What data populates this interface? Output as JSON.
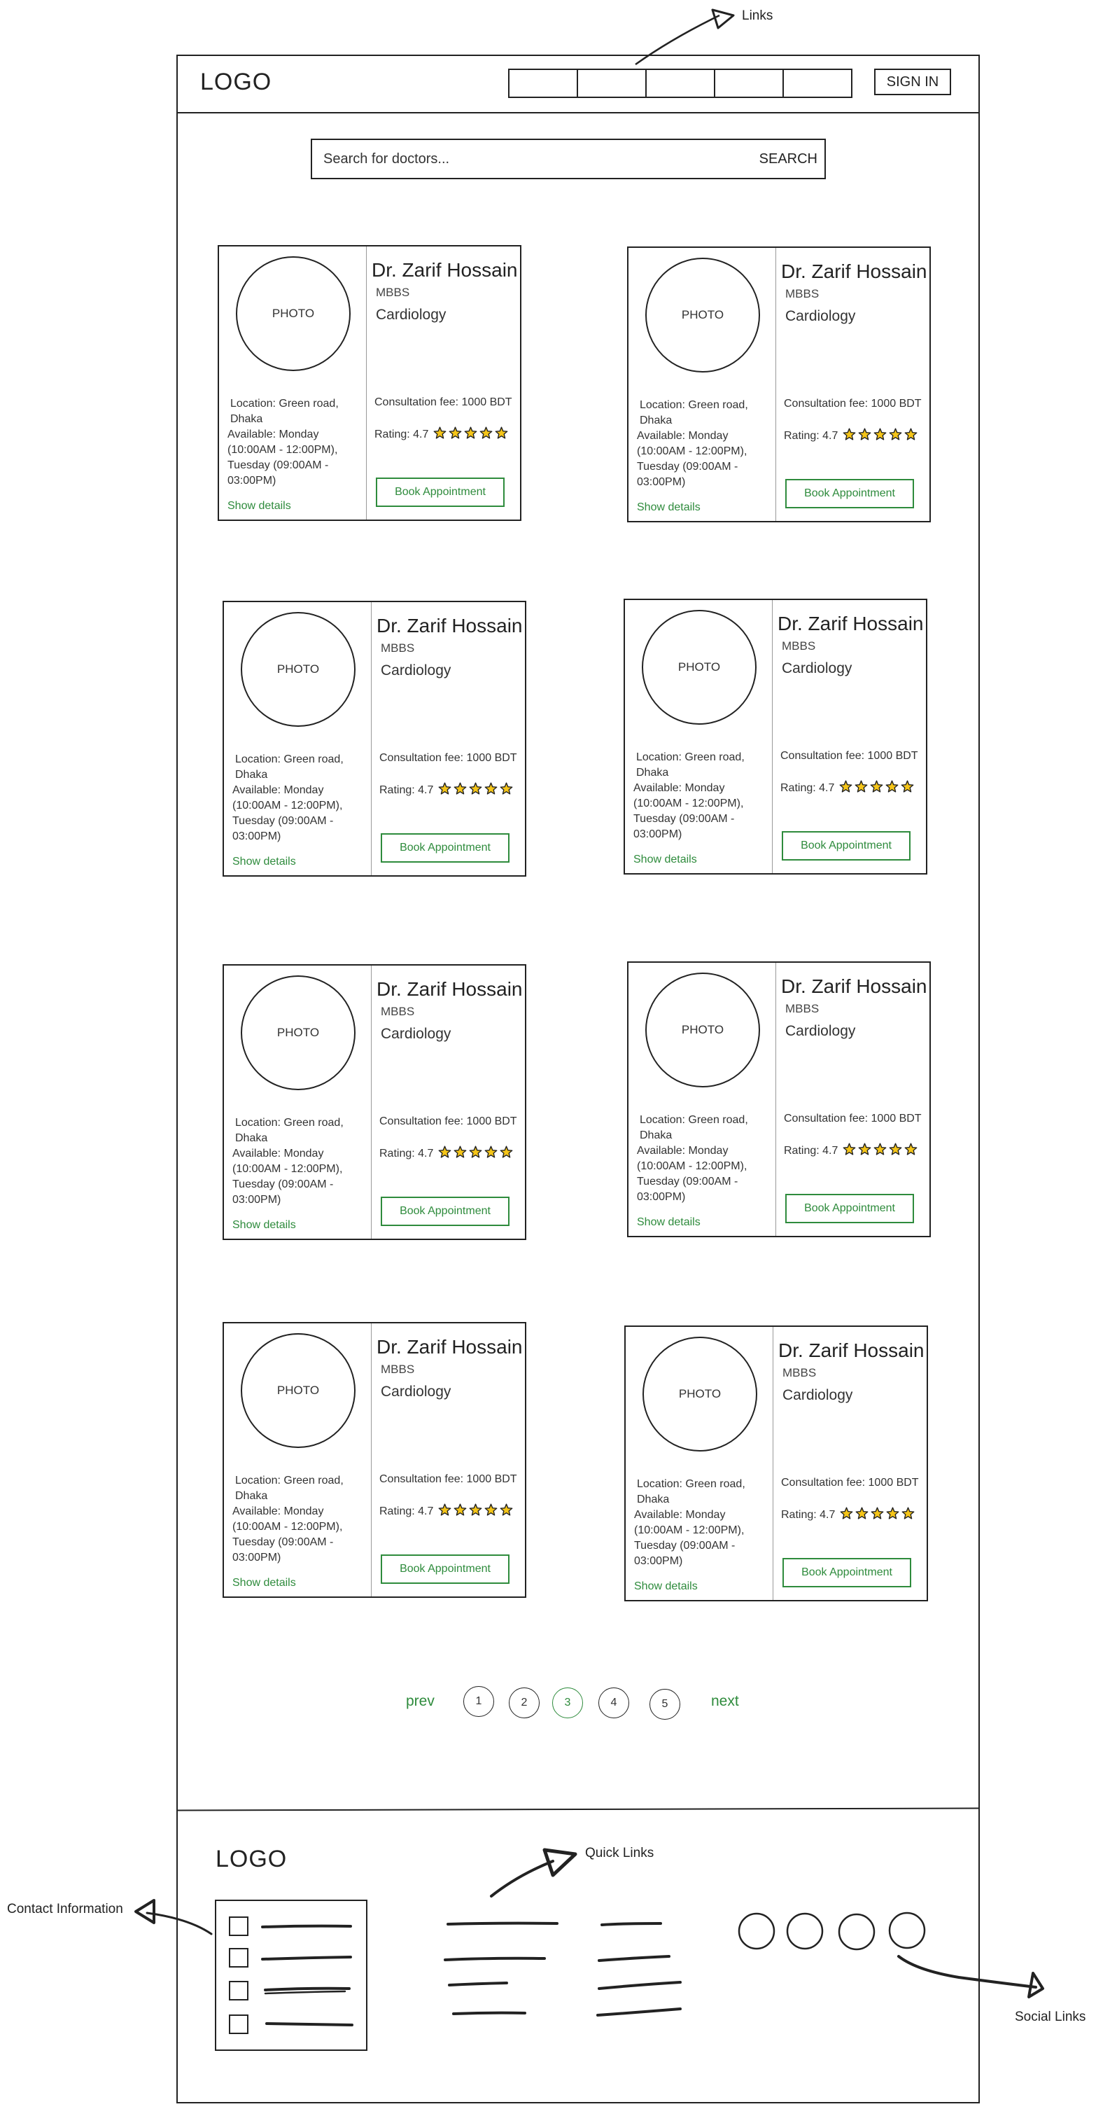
{
  "header": {
    "logo": "LOGO",
    "signin_label": "SIGN IN",
    "nav_link_count": 5
  },
  "search": {
    "placeholder": "Search for doctors...",
    "button_label": "SEARCH"
  },
  "doctor_cards": [
    {
      "photo_label": "PHOTO",
      "name": "Dr. Zarif Hossain",
      "degree": "MBBS",
      "specialty": "Cardiology",
      "location": "Location: Green road, Dhaka",
      "availability": "Available:  Monday (10:00AM - 12:00PM), Tuesday (09:00AM - 03:00PM)",
      "show_details": "Show details",
      "fee": "Consultation fee: 1000 BDT",
      "rating_label": "Rating: 4.7",
      "rating_stars": 5,
      "book_label": "Book Appointment"
    },
    {
      "photo_label": "PHOTO",
      "name": "Dr. Zarif Hossain",
      "degree": "MBBS",
      "specialty": "Cardiology",
      "location": "Location: Green road, Dhaka",
      "availability": "Available:  Monday (10:00AM - 12:00PM), Tuesday (09:00AM - 03:00PM)",
      "show_details": "Show details",
      "fee": "Consultation fee: 1000 BDT",
      "rating_label": "Rating: 4.7",
      "rating_stars": 5,
      "book_label": "Book Appointment"
    },
    {
      "photo_label": "PHOTO",
      "name": "Dr. Zarif Hossain",
      "degree": "MBBS",
      "specialty": "Cardiology",
      "location": "Location: Green road, Dhaka",
      "availability": "Available:  Monday (10:00AM - 12:00PM), Tuesday (09:00AM - 03:00PM)",
      "show_details": "Show details",
      "fee": "Consultation fee: 1000 BDT",
      "rating_label": "Rating: 4.7",
      "rating_stars": 5,
      "book_label": "Book Appointment"
    },
    {
      "photo_label": "PHOTO",
      "name": "Dr. Zarif Hossain",
      "degree": "MBBS",
      "specialty": "Cardiology",
      "location": "Location: Green road, Dhaka",
      "availability": "Available:  Monday (10:00AM - 12:00PM), Tuesday (09:00AM - 03:00PM)",
      "show_details": "Show details",
      "fee": "Consultation fee: 1000 BDT",
      "rating_label": "Rating: 4.7",
      "rating_stars": 5,
      "book_label": "Book Appointment"
    },
    {
      "photo_label": "PHOTO",
      "name": "Dr. Zarif Hossain",
      "degree": "MBBS",
      "specialty": "Cardiology",
      "location": "Location: Green road, Dhaka",
      "availability": "Available:  Monday (10:00AM - 12:00PM), Tuesday (09:00AM - 03:00PM)",
      "show_details": "Show details",
      "fee": "Consultation fee: 1000 BDT",
      "rating_label": "Rating: 4.7",
      "rating_stars": 5,
      "book_label": "Book Appointment"
    },
    {
      "photo_label": "PHOTO",
      "name": "Dr. Zarif Hossain",
      "degree": "MBBS",
      "specialty": "Cardiology",
      "location": "Location: Green road, Dhaka",
      "availability": "Available:  Monday (10:00AM - 12:00PM), Tuesday (09:00AM - 03:00PM)",
      "show_details": "Show details",
      "fee": "Consultation fee: 1000 BDT",
      "rating_label": "Rating: 4.7",
      "rating_stars": 5,
      "book_label": "Book Appointment"
    },
    {
      "photo_label": "PHOTO",
      "name": "Dr. Zarif Hossain",
      "degree": "MBBS",
      "specialty": "Cardiology",
      "location": "Location: Green road, Dhaka",
      "availability": "Available:  Monday (10:00AM - 12:00PM), Tuesday (09:00AM - 03:00PM)",
      "show_details": "Show details",
      "fee": "Consultation fee: 1000 BDT",
      "rating_label": "Rating: 4.7",
      "rating_stars": 5,
      "book_label": "Book Appointment"
    },
    {
      "photo_label": "PHOTO",
      "name": "Dr. Zarif Hossain",
      "degree": "MBBS",
      "specialty": "Cardiology",
      "location": "Location: Green road, Dhaka",
      "availability": "Available:  Monday (10:00AM - 12:00PM), Tuesday (09:00AM - 03:00PM)",
      "show_details": "Show details",
      "fee": "Consultation fee: 1000 BDT",
      "rating_label": "Rating: 4.7",
      "rating_stars": 5,
      "book_label": "Book Appointment"
    }
  ],
  "pagination": {
    "prev": "prev",
    "next": "next",
    "pages": [
      "1",
      "2",
      "3",
      "4",
      "5"
    ],
    "current": "3"
  },
  "footer": {
    "logo": "LOGO",
    "contact_item_count": 4,
    "social_icon_count": 4
  },
  "annotations": {
    "links": "Links",
    "quick_links": "Quick Links",
    "contact_information": "Contact Information",
    "social_links": "Social Links"
  },
  "colors": {
    "accent": "#2e8b3c",
    "ink": "#222222",
    "star": "#f5c518"
  },
  "icons": {
    "star": "star-icon",
    "checkbox": "checkbox-icon",
    "social": "social-circle-icon",
    "arrow": "arrow-icon"
  }
}
